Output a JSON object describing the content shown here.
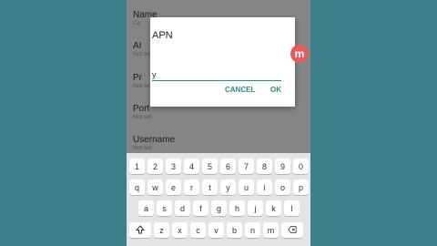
{
  "settings": {
    "items": [
      {
        "title": "Name",
        "sub": "Ca"
      },
      {
        "title": "AI",
        "sub": "Not set"
      },
      {
        "title": "Pr",
        "sub": "Not set"
      },
      {
        "title": "Port",
        "sub": "Not set"
      },
      {
        "title": "Username",
        "sub": "Not set"
      }
    ]
  },
  "dialog": {
    "title": "APN",
    "input_value": "y",
    "cancel_label": "CANCEL",
    "ok_label": "OK"
  },
  "keyboard": {
    "popup_key": "y",
    "row_numbers": [
      "1",
      "2",
      "3",
      "4",
      "5",
      "6",
      "7",
      "8",
      "9",
      "0"
    ],
    "row_top": [
      "q",
      "w",
      "e",
      "r",
      "t",
      "y",
      "u",
      "i",
      "o",
      "p"
    ],
    "row_middle": [
      "a",
      "s",
      "d",
      "f",
      "g",
      "h",
      "j",
      "k",
      "l"
    ],
    "row_bottom": [
      "z",
      "x",
      "c",
      "v",
      "b",
      "n",
      "m"
    ]
  },
  "colors": {
    "accent": "#2b8a8a",
    "background": "#3e7f8a",
    "badge": "#e35d5d"
  },
  "icons": {
    "shift": "shift-icon",
    "backspace": "backspace-icon"
  },
  "badge": {
    "text": "m"
  }
}
